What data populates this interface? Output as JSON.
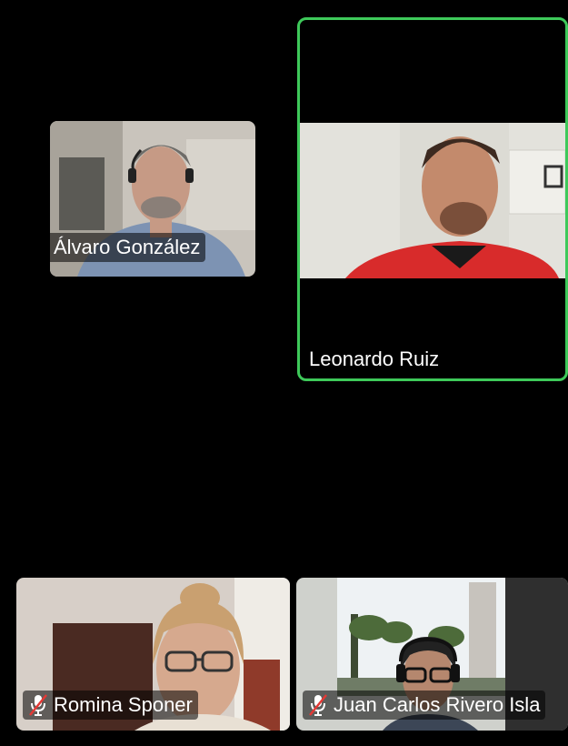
{
  "participants": [
    {
      "name": "Álvaro González",
      "muted": true,
      "speaking": false
    },
    {
      "name": "Leonardo Ruiz",
      "muted": false,
      "speaking": true
    },
    {
      "name": "Romina Sponer",
      "muted": true,
      "speaking": false
    },
    {
      "name": "Juan Carlos Rivero Isla",
      "muted": true,
      "speaking": false
    }
  ],
  "colors": {
    "active_speaker_border": "#3ec95a",
    "muted_slash": "#e53935",
    "background": "#000000"
  },
  "icons": {
    "muted": "microphone-muted-icon"
  }
}
